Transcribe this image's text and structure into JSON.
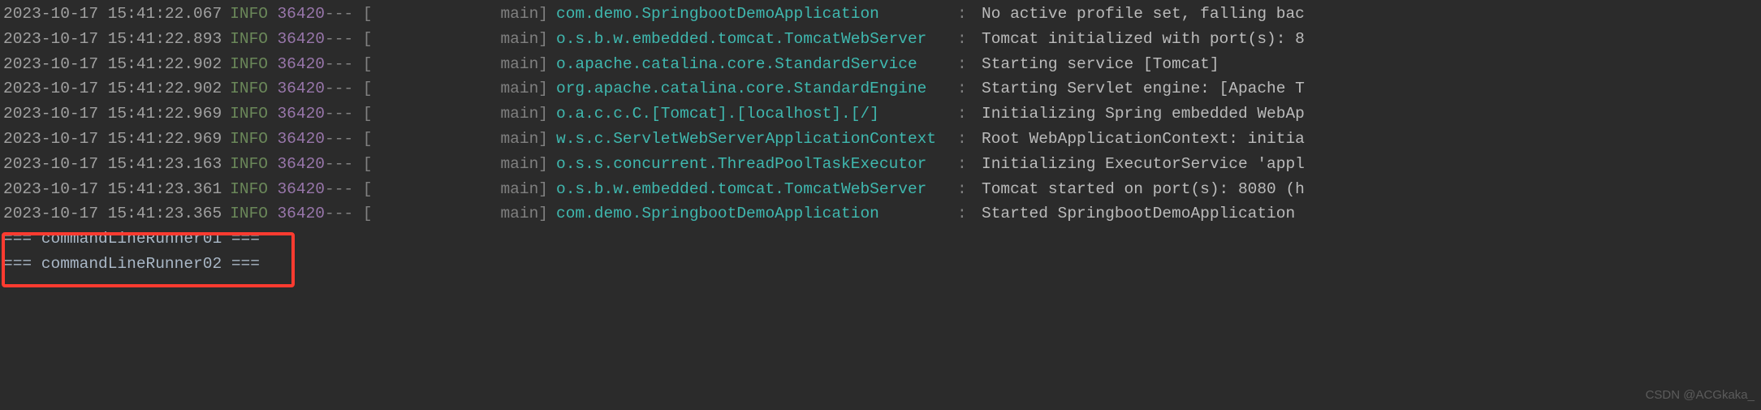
{
  "logs": [
    {
      "timestamp": "2023-10-17 15:41:22.067",
      "level": "INFO",
      "pid": "36420",
      "sep": " --- [",
      "thread": "main]",
      "logger": "com.demo.SpringbootDemoApplication",
      "colon": ":",
      "message": "No active profile set, falling bac"
    },
    {
      "timestamp": "2023-10-17 15:41:22.893",
      "level": "INFO",
      "pid": "36420",
      "sep": " --- [",
      "thread": "main]",
      "logger": "o.s.b.w.embedded.tomcat.TomcatWebServer",
      "colon": ":",
      "message": "Tomcat initialized with port(s): 8"
    },
    {
      "timestamp": "2023-10-17 15:41:22.902",
      "level": "INFO",
      "pid": "36420",
      "sep": " --- [",
      "thread": "main]",
      "logger": "o.apache.catalina.core.StandardService",
      "colon": ":",
      "message": "Starting service [Tomcat]"
    },
    {
      "timestamp": "2023-10-17 15:41:22.902",
      "level": "INFO",
      "pid": "36420",
      "sep": " --- [",
      "thread": "main]",
      "logger": "org.apache.catalina.core.StandardEngine",
      "colon": ":",
      "message": "Starting Servlet engine: [Apache T"
    },
    {
      "timestamp": "2023-10-17 15:41:22.969",
      "level": "INFO",
      "pid": "36420",
      "sep": " --- [",
      "thread": "main]",
      "logger": "o.a.c.c.C.[Tomcat].[localhost].[/]",
      "colon": ":",
      "message": "Initializing Spring embedded WebAp"
    },
    {
      "timestamp": "2023-10-17 15:41:22.969",
      "level": "INFO",
      "pid": "36420",
      "sep": " --- [",
      "thread": "main]",
      "logger": "w.s.c.ServletWebServerApplicationContext",
      "colon": ":",
      "message": "Root WebApplicationContext: initia"
    },
    {
      "timestamp": "2023-10-17 15:41:23.163",
      "level": "INFO",
      "pid": "36420",
      "sep": " --- [",
      "thread": "main]",
      "logger": "o.s.s.concurrent.ThreadPoolTaskExecutor",
      "colon": ":",
      "message": "Initializing ExecutorService 'appl"
    },
    {
      "timestamp": "2023-10-17 15:41:23.361",
      "level": "INFO",
      "pid": "36420",
      "sep": " --- [",
      "thread": "main]",
      "logger": "o.s.b.w.embedded.tomcat.TomcatWebServer",
      "colon": ":",
      "message": "Tomcat started on port(s): 8080 (h"
    },
    {
      "timestamp": "2023-10-17 15:41:23.365",
      "level": "INFO",
      "pid": "36420",
      "sep": " --- [",
      "thread": "main]",
      "logger": "com.demo.SpringbootDemoApplication",
      "colon": ":",
      "message": "Started SpringbootDemoApplication"
    }
  ],
  "plain": [
    "=== commandLineRunner01 ===",
    "=== commandLineRunner02 ==="
  ],
  "watermark": "CSDN @ACGkaka_"
}
